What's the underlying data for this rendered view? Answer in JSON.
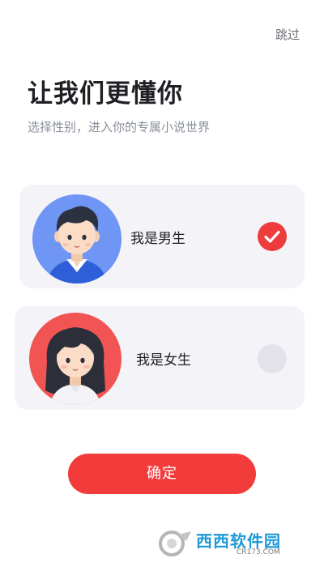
{
  "header": {
    "skip_label": "跳过",
    "title": "让我们更懂你",
    "subtitle": "选择性别，进入你的专属小说世界"
  },
  "options": [
    {
      "label": "我是男生",
      "selected": true,
      "avatar_icon": "boy-avatar-icon"
    },
    {
      "label": "我是女生",
      "selected": false,
      "avatar_icon": "girl-avatar-icon"
    }
  ],
  "confirm_label": "确定",
  "watermark": {
    "brand": "西西软件园",
    "site": "CR173.COM"
  },
  "colors": {
    "accent": "#F23C3C",
    "card_bg": "#F4F4F8",
    "male_avatar_bg": "#6F95F5",
    "female_avatar_bg": "#F25454",
    "unselected_radio": "#E1E2EA"
  }
}
